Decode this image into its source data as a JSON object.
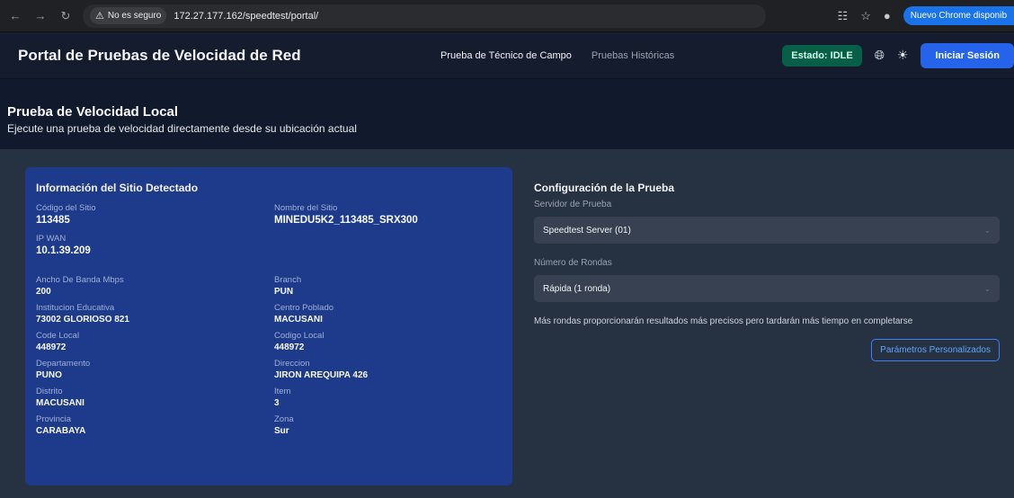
{
  "browser": {
    "security_label": "No es seguro",
    "url": "172.27.177.162/speedtest/portal/",
    "update_label": "Nuevo Chrome disponib"
  },
  "header": {
    "title": "Portal de Pruebas de Velocidad de Red",
    "nav_active": "Prueba de Técnico de Campo",
    "nav_history": "Pruebas Históricas",
    "status": "Estado: IDLE",
    "login": "Iniciar Sesión"
  },
  "page": {
    "title": "Prueba de Velocidad Local",
    "subtitle": "Ejecute una prueba de velocidad directamente desde su ubicación actual"
  },
  "site": {
    "title": "Información del Sitio Detectado",
    "codigo_label": "Código del Sitio",
    "codigo": "113485",
    "nombre_label": "Nombre del Sitio",
    "nombre": "MINEDU5K2_113485_SRX300",
    "ip_label": "IP WAN",
    "ip": "10.1.39.209",
    "fields": [
      {
        "label": "Ancho De Banda Mbps",
        "value": "200"
      },
      {
        "label": "Branch",
        "value": "PUN"
      },
      {
        "label": "Institucion Educativa",
        "value": "73002 GLORIOSO 821"
      },
      {
        "label": "Centro Poblado",
        "value": "MACUSANI"
      },
      {
        "label": "Code Local",
        "value": "448972"
      },
      {
        "label": "Codigo Local",
        "value": "448972"
      },
      {
        "label": "Departamento",
        "value": "PUNO"
      },
      {
        "label": "Direccion",
        "value": "JIRON AREQUIPA 426"
      },
      {
        "label": "Distrito",
        "value": "MACUSANI"
      },
      {
        "label": "Item",
        "value": "3"
      },
      {
        "label": "Provincia",
        "value": "CARABAYA"
      },
      {
        "label": "Zona",
        "value": "Sur"
      }
    ]
  },
  "config": {
    "title": "Configuración de la Prueba",
    "server_label": "Servidor de Prueba",
    "server_value": "Speedtest Server (01)",
    "rounds_label": "Número de Rondas",
    "rounds_value": "Rápida (1 ronda)",
    "note": "Más rondas proporcionarán resultados más precisos pero tardarán más tiempo en completarse",
    "custom_button": "Parámetros Personalizados"
  }
}
